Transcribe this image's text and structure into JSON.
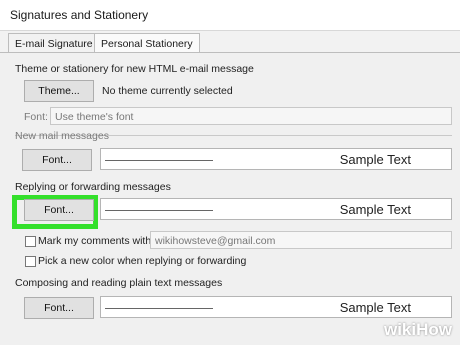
{
  "window": {
    "title": "Signatures and Stationery"
  },
  "tabs": [
    {
      "label": "E-mail Signature"
    },
    {
      "label": "Personal Stationery"
    }
  ],
  "theme": {
    "heading": "Theme or stationery for new HTML e-mail message",
    "button": "Theme...",
    "status": "No theme currently selected",
    "font_label": "Font:",
    "font_value": "Use theme's font"
  },
  "new_mail": {
    "heading": "New mail messages",
    "font_button": "Font...",
    "sample": "Sample Text"
  },
  "reply": {
    "heading": "Replying or forwarding messages",
    "font_button": "Font...",
    "sample": "Sample Text",
    "mark_comments_label": "Mark my comments with:",
    "mark_comments_value": "wikihowsteve@gmail.com",
    "new_color_label": "Pick a new color when replying or forwarding"
  },
  "plain": {
    "heading": "Composing and reading plain text messages",
    "font_button": "Font...",
    "sample": "Sample Text"
  },
  "watermark": {
    "wiki": "wiki",
    "how": "How"
  },
  "colors": {
    "highlight": "#34e02b"
  }
}
